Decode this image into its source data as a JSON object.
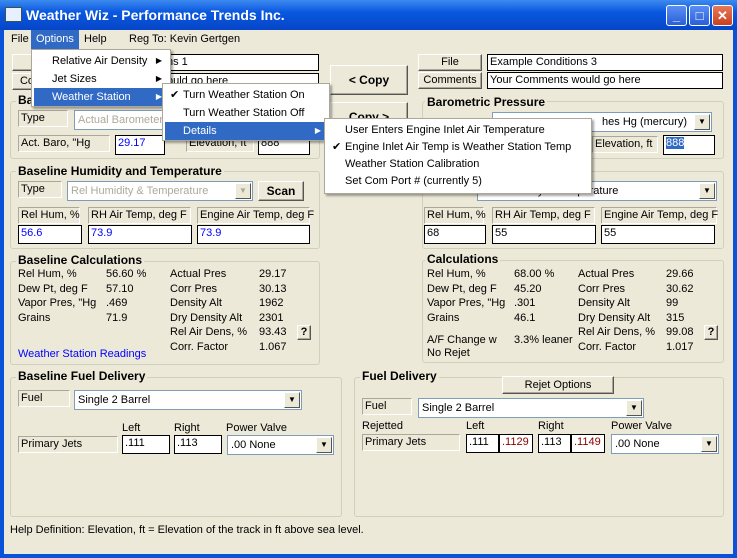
{
  "window": {
    "title": "Weather Wiz - Performance Trends Inc.",
    "minimize": "_",
    "maximize": "□",
    "close": "✕"
  },
  "menubar": {
    "items": [
      "File",
      "Options",
      "Help"
    ],
    "reg": "Reg To: Kevin Gertgen"
  },
  "options_menu": {
    "items": [
      {
        "label": "Relative Air Density",
        "arrow": "▶"
      },
      {
        "label": "Jet Sizes",
        "arrow": "▶"
      },
      {
        "label": "Weather Station",
        "arrow": "▶"
      }
    ]
  },
  "weather_menu": {
    "items": [
      {
        "label": "Turn Weather Station On",
        "check": "✔"
      },
      {
        "label": "Turn Weather Station Off"
      },
      {
        "label": "Details",
        "arrow": "▶"
      }
    ]
  },
  "details_menu": {
    "items": [
      {
        "label": "User Enters Engine Inlet Air Temperature"
      },
      {
        "label": "Engine Inlet Air Temp is Weather Station Temp",
        "check": "✔"
      },
      {
        "label": "Weather Station Calibration"
      },
      {
        "label": "Set Com Port # (currently 5)"
      }
    ]
  },
  "left": {
    "file_fragment": "ns 1",
    "comments_btn": "Co",
    "comments_fragment": "ould go here",
    "baro": {
      "title": "Ba",
      "type_label": "Type",
      "type_value": "Actual Barometer,",
      "act_baro_label": "Act. Baro, \"Hg",
      "act_baro": "29.17",
      "elev_label": "Elevation, ft",
      "elev": "888"
    },
    "hum": {
      "title": "Baseline Humidity and Temperature",
      "type_label": "Type",
      "type_value": "Rel Humidity & Temperature",
      "scan": "Scan",
      "rh_label": "Rel Hum, %",
      "rh": "56.6",
      "rht_label": "RH Air Temp, deg F",
      "rht": "73.9",
      "eat_label": "Engine Air Temp, deg F",
      "eat": "73.9"
    },
    "calc": {
      "title": "Baseline Calculations",
      "left": [
        [
          "Rel Hum, %",
          "56.60 %"
        ],
        [
          "Dew Pt, deg F",
          "57.10"
        ],
        [
          "Vapor Pres, \"Hg",
          ".469"
        ],
        [
          "Grains",
          "71.9"
        ]
      ],
      "right": [
        [
          "Actual Pres",
          "29.17"
        ],
        [
          "Corr Pres",
          "30.13"
        ],
        [
          "Density Alt",
          "1962"
        ],
        [
          "Dry Density Alt",
          "2301"
        ],
        [
          "Rel Air Dens, %",
          "93.43"
        ],
        [
          "Corr. Factor",
          "1.067"
        ]
      ],
      "help": "?",
      "link": "Weather Station Readings"
    },
    "fuel": {
      "title": "Baseline Fuel Delivery",
      "fuel_label": "Fuel",
      "fuel_value": "Single 2 Barrel",
      "left": "Left",
      "right": "Right",
      "pv": "Power Valve",
      "jets_label": "Primary Jets",
      "left_val": ".111",
      "right_val": ".113",
      "pv_val": ".00 None"
    }
  },
  "copy_left": "< Copy",
  "copy_right": "Copy >",
  "right": {
    "file_btn": "File",
    "file": "Example Conditions 3",
    "comments_btn": "Comments",
    "comments": "Your Comments would go here",
    "baro": {
      "title": "Barometric Pressure",
      "type_fragment": "hes Hg (mercury)",
      "elev_label": "Elevation, ft",
      "elev": "888"
    },
    "hum": {
      "type_value": "Rel Humidity & Temperature",
      "rh_label": "Rel Hum, %",
      "rh": "68",
      "rht_label": "RH Air Temp, deg F",
      "rht": "55",
      "eat_label": "Engine Air Temp, deg F",
      "eat": "55"
    },
    "calc": {
      "title": "Calculations",
      "left": [
        [
          "Rel Hum, %",
          "68.00 %"
        ],
        [
          "Dew Pt, deg F",
          "45.20"
        ],
        [
          "Vapor Pres, \"Hg",
          ".301"
        ],
        [
          "Grains",
          "46.1"
        ]
      ],
      "right": [
        [
          "Actual Pres",
          "29.66"
        ],
        [
          "Corr Pres",
          "30.62"
        ],
        [
          "Density Alt",
          "99"
        ],
        [
          "Dry Density Alt",
          "315"
        ],
        [
          "Rel Air Dens, %",
          "99.08"
        ],
        [
          "Corr. Factor",
          "1.017"
        ]
      ],
      "af_label": "A/F Change w No Rejet",
      "af": "3.3% leaner",
      "help": "?"
    },
    "fuel": {
      "title": "Fuel Delivery",
      "rejet": "Rejet Options",
      "fuel_label": "Fuel",
      "fuel_value": "Single 2 Barrel",
      "rejetted": "Rejetted",
      "left": "Left",
      "right": "Right",
      "pv": "Power Valve",
      "jets_label": "Primary Jets",
      "left_val": ".111",
      "left_rej": ".1129",
      "right_val": ".113",
      "right_rej": ".1149",
      "pv_val": ".00 None"
    }
  },
  "help_def": "Help Definition:  Elevation, ft = Elevation of the track in ft above sea level."
}
